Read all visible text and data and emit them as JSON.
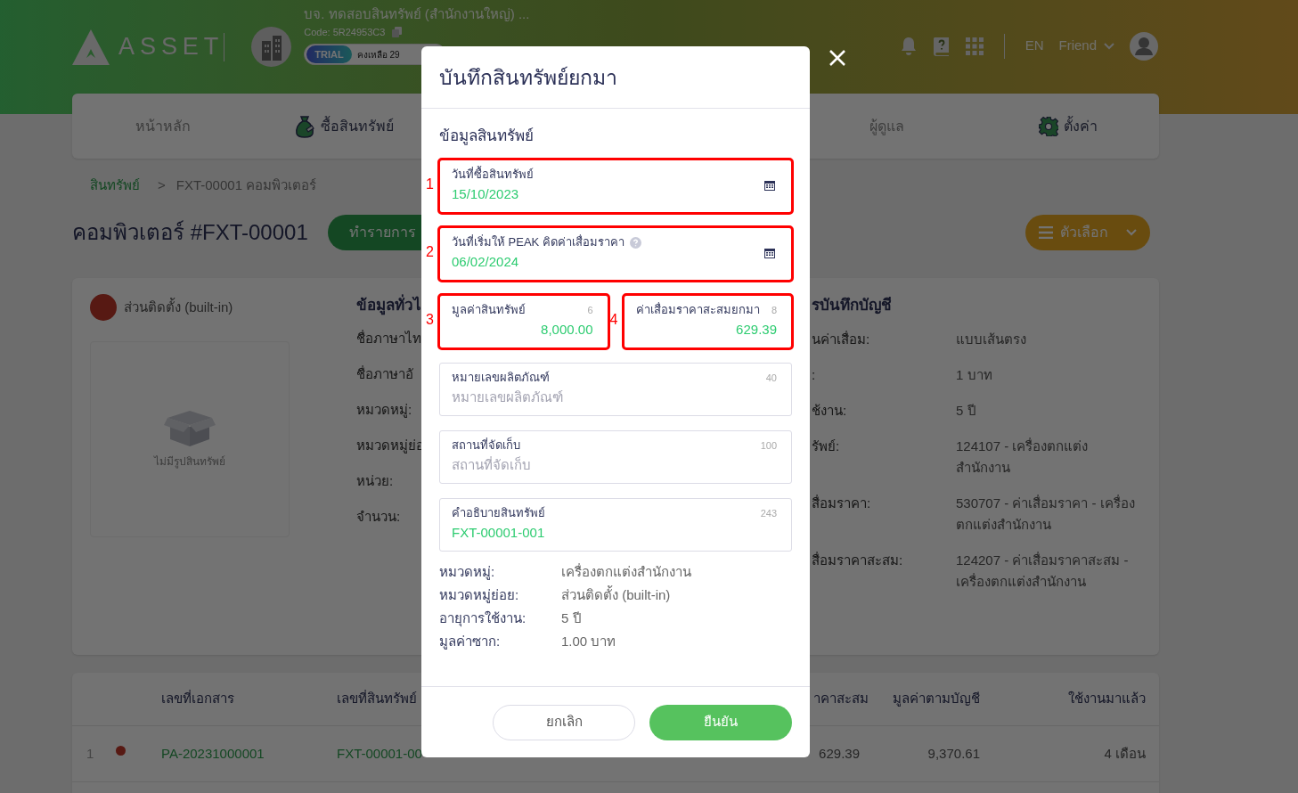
{
  "header": {
    "logo_text": "ASSET",
    "company_name": "บจ. ทดสอบสินทรัพย์ (สำนักงานใหญ่) ...",
    "company_code": "Code: 5R24953C3",
    "plan_badge": "TRIAL",
    "plan_remaining": "คงเหลือ 29",
    "language": "EN",
    "user_name": "Friend"
  },
  "nav": [
    {
      "label": "หน้าหลัก",
      "disabled": true
    },
    {
      "label": "ซื้อสินทรัพย์",
      "disabled": false
    },
    {
      "label": "ผู้ดูแล",
      "disabled": true
    },
    {
      "label": "ตั้งค่า",
      "disabled": false
    }
  ],
  "breadcrumb": {
    "items": [
      "สินทรัพย์",
      "FXT-00001 คอมพิวเตอร์"
    ],
    "separator": ">"
  },
  "page_title": "คอมพิวเตอร์ #FXT-00001",
  "action_button": "ทำรายการ",
  "options_button": "ตัวเลือก",
  "asset_card": {
    "category": "ส่วนติดตั้ง (built-in)",
    "image_placeholder": "ไม่มีรูปสินทรัพย์",
    "general_title": "ข้อมูลทั่วไ",
    "general_labels": [
      "ชื่อภาษาไท",
      "ชื่อภาษาอั",
      "หมวดหมู่:",
      "หมวดหมู่ย่อ",
      "หน่วย:",
      "จำนวน:"
    ],
    "accounting_title": "รบันทึกบัญชี",
    "accounting_rows": [
      {
        "label": "นค่าเสื่อม:",
        "value": "แบบเส้นตรง"
      },
      {
        "label": ":",
        "value": "1 บาท"
      },
      {
        "label": "ช้งาน:",
        "value": "5 ปี"
      },
      {
        "label": "รัพย์:",
        "value": "124107 - เครื่องตกแต่ง สำนักงาน"
      },
      {
        "label": "สื่อมราคา:",
        "value": "530707 - ค่าเสื่อมราคา - เครื่อง ตกแต่งสำนักงาน"
      },
      {
        "label": "สื่อมราคาสะสม:",
        "value": "124207 - ค่าเสื่อมราคาสะสม - เครื่องตกแต่งสำนักงาน"
      }
    ]
  },
  "table": {
    "columns": [
      "เลขที่เอกสาร",
      "เลขที่สินทรัพย์",
      "าคาสะสม",
      "มูลค่าตามบัญชี",
      "ใช้งานมาแล้ว"
    ],
    "rows": [
      {
        "index": "1",
        "document_no": "PA-20231000001",
        "asset_no": "FXT-00001-00",
        "accumulated": "629.39",
        "book_value": "9,370.61",
        "used_for": "4 เดือน"
      }
    ]
  },
  "modal": {
    "title": "บันทึกสินทรัพย์ยกมา",
    "section_title": "ข้อมูลสินทรัพย์",
    "fields": [
      {
        "kind": "date",
        "label": "วันที่ซื้อสินทรัพย์",
        "value": "15/10/2023",
        "annotation": "1"
      },
      {
        "kind": "date",
        "label": "วันที่เริ่มให้ PEAK คิดค่าเสื่อมราคา",
        "help": true,
        "value": "06/02/2024",
        "annotation": "2"
      },
      {
        "kind": "amount",
        "label": "มูลค่าสินทรัพย์",
        "counter": "6",
        "value": "8,000.00",
        "annotation": "3"
      },
      {
        "kind": "amount",
        "label": "ค่าเสื่อมราคาสะสมยกมา",
        "counter": "8",
        "value": "629.39",
        "annotation": "4"
      },
      {
        "kind": "text",
        "label": "หมายเลขผลิตภัณฑ์",
        "counter": "40",
        "placeholder": "หมายเลขผลิตภัณฑ์"
      },
      {
        "kind": "text",
        "label": "สถานที่จัดเก็บ",
        "counter": "100",
        "placeholder": "สถานที่จัดเก็บ"
      },
      {
        "kind": "text",
        "label": "คำอธิบายสินทรัพย์",
        "counter": "243",
        "value": "FXT-00001-001"
      }
    ],
    "summary": [
      {
        "label": "หมวดหมู่:",
        "value": "เครื่องตกแต่งสำนักงาน"
      },
      {
        "label": "หมวดหมู่ย่อย:",
        "value": "ส่วนติดตั้ง (built-in)"
      },
      {
        "label": "อายุการใช้งาน:",
        "value": "5 ปี"
      },
      {
        "label": "มูลค่าซาก:",
        "value": "1.00 บาท"
      }
    ],
    "cancel_button": "ยกเลิก",
    "confirm_button": "ยืนยัน"
  }
}
